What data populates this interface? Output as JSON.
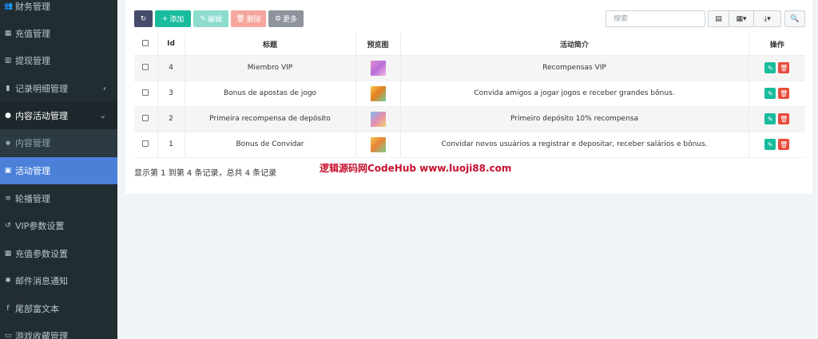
{
  "sidebar": {
    "items": [
      {
        "icon": "users-icon",
        "glyph": "👥",
        "label": "财务管理"
      },
      {
        "icon": "grid-icon",
        "glyph": "▦",
        "label": "充值管理"
      },
      {
        "icon": "building-icon",
        "glyph": "▥",
        "label": "提现管理"
      },
      {
        "icon": "bar-chart-icon",
        "glyph": "▮",
        "label": "记录明细管理",
        "chevron": "‹"
      },
      {
        "icon": "circle-icon",
        "glyph": "●",
        "label": "内容活动管理",
        "chevron": "⌄"
      },
      {
        "icon": "dot-icon",
        "glyph": "●",
        "label": "内容管理"
      },
      {
        "icon": "calendar-icon",
        "glyph": "▣",
        "label": "活动管理"
      },
      {
        "icon": "list-icon",
        "glyph": "≡",
        "label": "轮播管理"
      },
      {
        "icon": "history-icon",
        "glyph": "↺",
        "label": "VIP参数设置"
      },
      {
        "icon": "grid-icon",
        "glyph": "▦",
        "label": "充值参数设置"
      },
      {
        "icon": "asterisk-icon",
        "glyph": "✱",
        "label": "邮件消息通知"
      },
      {
        "icon": "facebook-icon",
        "glyph": "f",
        "label": "尾部富文本"
      },
      {
        "icon": "folder-icon",
        "glyph": "▭",
        "label": "游戏收藏管理"
      }
    ]
  },
  "toolbar": {
    "refresh_glyph": "↻",
    "add_label": "添加",
    "edit_label": "编辑",
    "delete_label": "删除",
    "more_label": "更多",
    "search_placeholder": "搜索"
  },
  "table": {
    "headers": {
      "id": "Id",
      "title": "标题",
      "preview": "预览图",
      "summary": "活动简介",
      "ops": "操作"
    },
    "rows": [
      {
        "id": "4",
        "title": "Miembro VIP",
        "summary": "Recompensas VIP"
      },
      {
        "id": "3",
        "title": "Bonus de apostas de jogo",
        "summary": "Convida amigos a jogar jogos e receber grandes bônus."
      },
      {
        "id": "2",
        "title": "Primeira recompensa de depósito",
        "summary": "Primeiro depósito 10% recompensa"
      },
      {
        "id": "1",
        "title": "Bonus de Convidar",
        "summary": "Convidar novos usuários a registrar e depositar, receber salários e bônus."
      }
    ]
  },
  "pagination_summary": "显示第 1 到第 4 条记录，总共 4 条记录",
  "watermark": "逻辑源码网CodeHub www.luoji88.com",
  "colors": {
    "sidebar_bg": "#222d32",
    "active": "#4b80d9",
    "success": "#18bc9c",
    "danger": "#e74c3c",
    "dark": "#444c69"
  }
}
